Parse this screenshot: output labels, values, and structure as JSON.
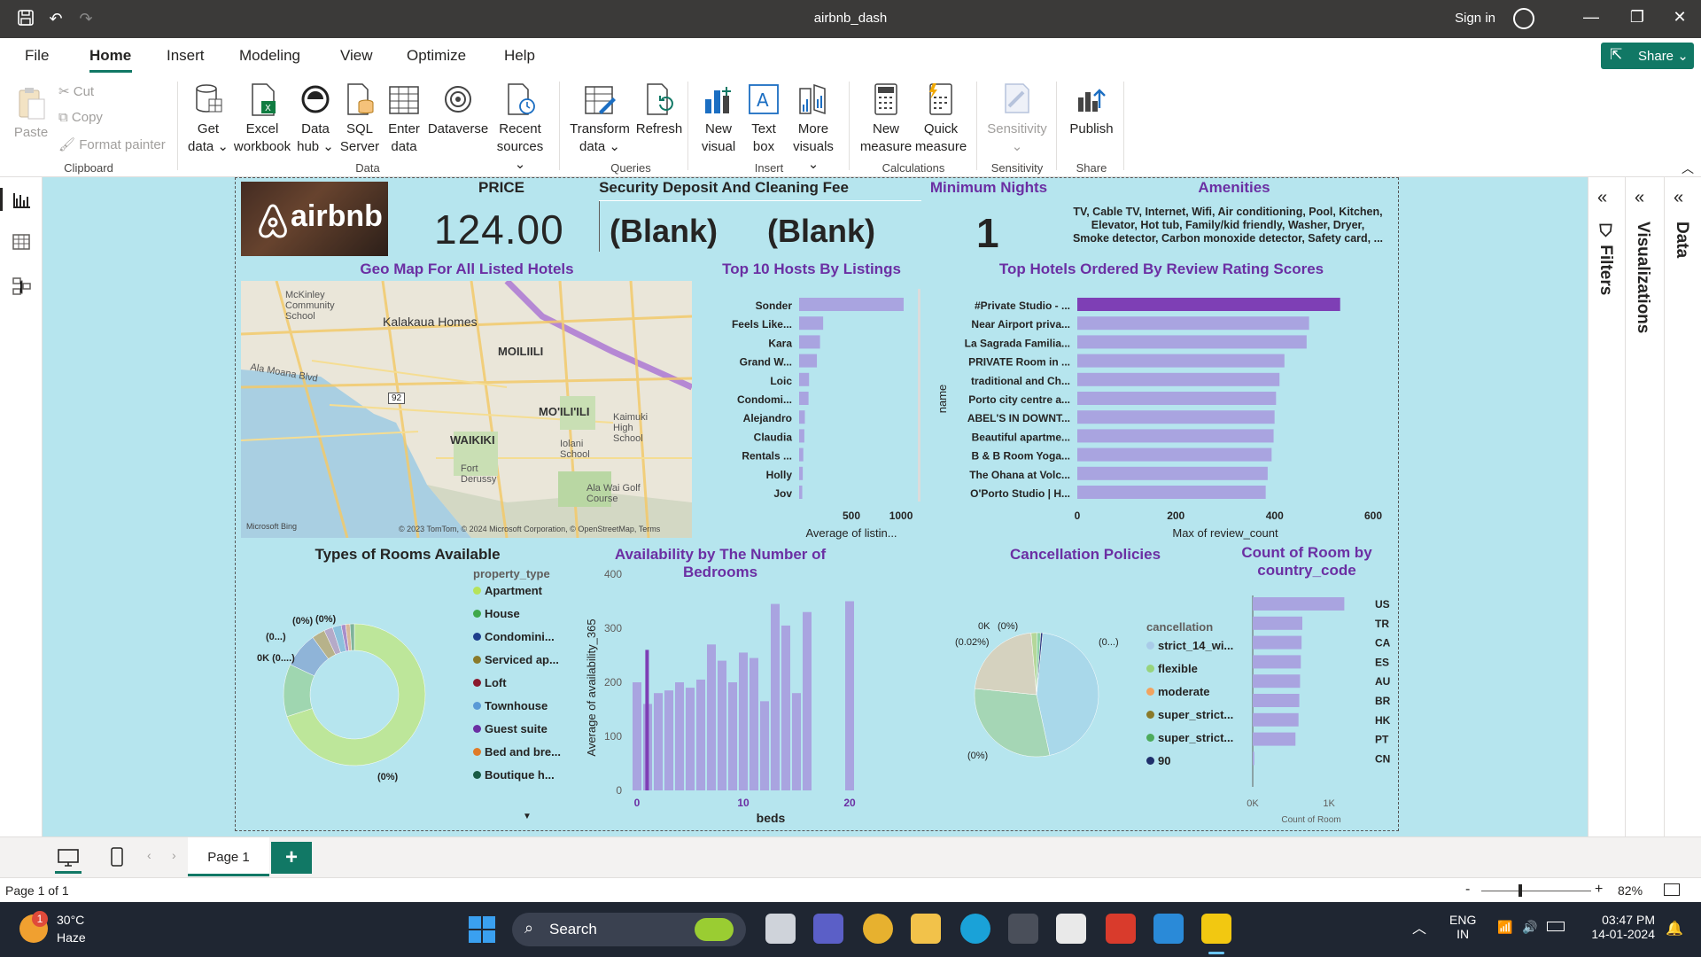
{
  "window": {
    "title": "airbnb_dash",
    "sign_in": "Sign in"
  },
  "menu": {
    "items": [
      "File",
      "Home",
      "Insert",
      "Modeling",
      "View",
      "Optimize",
      "Help"
    ],
    "active": "Home",
    "share": "Share"
  },
  "ribbon": {
    "clipboard": {
      "paste": "Paste",
      "cut": "Cut",
      "copy": "Copy",
      "format_painter": "Format painter",
      "label": "Clipboard"
    },
    "data": {
      "get_data": "Get data",
      "excel": "Excel workbook",
      "data_hub": "Data hub",
      "sql": "SQL Server",
      "enter": "Enter data",
      "dataverse": "Dataverse",
      "recent": "Recent sources",
      "label": "Data"
    },
    "queries": {
      "transform": "Transform data",
      "refresh": "Refresh",
      "label": "Queries"
    },
    "insert": {
      "new_visual": "New visual",
      "text_box": "Text box",
      "more": "More visuals",
      "label": "Insert"
    },
    "calc": {
      "new_measure": "New measure",
      "quick": "Quick measure",
      "label": "Calculations"
    },
    "sensitivity": {
      "btn": "Sensitivity",
      "label": "Sensitivity"
    },
    "share": {
      "publish": "Publish",
      "label": "Share"
    }
  },
  "report": {
    "logo_text": "airbnb",
    "price": {
      "title": "PRICE",
      "value": "124.00"
    },
    "deposit": {
      "title": "Security Deposit And Cleaning Fee",
      "v1": "(Blank)",
      "v2": "(Blank)"
    },
    "min_nights": {
      "title": "Minimum Nights",
      "value": "1"
    },
    "amenities": {
      "title": "Amenities",
      "line1": "TV, Cable TV, Internet, Wifi, Air conditioning, Pool, Kitchen,",
      "line2": "Elevator, Hot tub, Family/kid friendly, Washer, Dryer,",
      "line3": "Smoke detector, Carbon monoxide detector, Safety card, ..."
    },
    "map": {
      "title": "Geo Map For All Listed Hotels",
      "bing": "Microsoft Bing",
      "copyright": "© 2023 TomTom, © 2024 Microsoft Corporation, © OpenStreetMap, Terms",
      "places": [
        "McKinley Community School",
        "Kalakaua Homes",
        "MOILIILI",
        "MO'ILI'ILI",
        "Ala Moana Blvd",
        "WAIKIKI",
        "Fort Derussy",
        "Iolani School",
        "Ala Wai Golf Course",
        "Kaimuki High School",
        "92"
      ]
    },
    "donut": {
      "title": "Types of Rooms Available",
      "legend_title": "property_type",
      "labels": [
        "(0%)",
        "(0...)",
        "0K (0....)",
        "(0%)"
      ],
      "bottom_label": "(0%)"
    },
    "pie": {
      "title": "Cancellation Policies",
      "legend_title": "cancellation",
      "labels": [
        "0K",
        "(0%)",
        "(0.02%)",
        "(0...)",
        "(0%)"
      ]
    },
    "country": {
      "title_line1": "Count of Room by",
      "title_line2": "country_code",
      "xlabel": "Count of Room"
    }
  },
  "chart_data": [
    {
      "type": "bar",
      "orientation": "horizontal",
      "title": "Top 10 Hosts By Listings",
      "categories": [
        "Sonder",
        "Feels Like...",
        "Kara",
        "Grand W...",
        "Loic",
        "Condomi...",
        "Alejandro",
        "Claudia",
        "Rentals ...",
        "Holly",
        "Jov"
      ],
      "values": [
        1000,
        230,
        200,
        170,
        95,
        90,
        55,
        50,
        40,
        35,
        30
      ],
      "xlabel": "Average of listin...",
      "xticks": [
        "500",
        "1000"
      ],
      "xlim": [
        0,
        1000
      ],
      "color": "#a9a4e0"
    },
    {
      "type": "bar",
      "orientation": "horizontal",
      "title": "Top Hotels Ordered By Review Rating Scores",
      "categories": [
        "#Private Studio - ...",
        "Near Airport priva...",
        "La Sagrada Familia...",
        "PRIVATE Room in ...",
        "traditional and Ch...",
        "Porto city centre a...",
        "ABEL'S IN DOWNT...",
        "Beautiful apartme...",
        "B & B Room Yoga...",
        "The Ohana at Volc...",
        "O'Porto Studio | H..."
      ],
      "values": [
        533,
        470,
        465,
        420,
        410,
        403,
        400,
        398,
        394,
        386,
        382
      ],
      "xlabel": "Max of review_count",
      "ylabel": "name",
      "xticks": [
        "0",
        "200",
        "400",
        "600"
      ],
      "xlim": [
        0,
        600
      ],
      "color": "#a9a4e0",
      "highlight_color": "#7e3fb5"
    },
    {
      "type": "bar",
      "title": "Availability by The Number of Bedrooms",
      "x": [
        0,
        1,
        1.2,
        2,
        3,
        4,
        5,
        6,
        7,
        8,
        9,
        10,
        11,
        12,
        13,
        14,
        15,
        16,
        20
      ],
      "values": [
        200,
        160,
        260,
        180,
        185,
        200,
        190,
        205,
        270,
        240,
        200,
        255,
        245,
        165,
        345,
        305,
        180,
        330,
        350
      ],
      "xlabel": "beds",
      "ylabel": "Average of availability_365",
      "yticks": [
        "0",
        "100",
        "200",
        "300",
        "400"
      ],
      "xticks": [
        "0",
        "10",
        "20"
      ],
      "ylim": [
        0,
        400
      ],
      "color": "#a9a4e0",
      "highlight_color": "#7e3fb5"
    },
    {
      "type": "pie",
      "subtype": "donut",
      "title": "Types of Rooms Available",
      "categories": [
        "Apartment",
        "House",
        "Condomini...",
        "Serviced ap...",
        "Loft",
        "Townhouse",
        "Guest suite",
        "Bed and bre...",
        "Boutique h..."
      ],
      "values": [
        70,
        12,
        8,
        3,
        2,
        2,
        1,
        1,
        1
      ],
      "colors": [
        "#bde69a",
        "#9fd6b0",
        "#8fb4d8",
        "#b7b28a",
        "#b5aac8",
        "#8cc1dc",
        "#a98ec9",
        "#d8b99b",
        "#7fb39a"
      ],
      "legend_colors": [
        "#b6e35a",
        "#3fa84a",
        "#1f3f8c",
        "#8a7a2a",
        "#8b1a2e",
        "#5a9ad6",
        "#6b2fa3",
        "#e07b28",
        "#185b45"
      ]
    },
    {
      "type": "pie",
      "title": "Cancellation Policies",
      "categories": [
        "strict_14_wi...",
        "flexible",
        "moderate",
        "super_strict...",
        "super_strict...",
        "90"
      ],
      "values": [
        45,
        30,
        22,
        1.5,
        1,
        0.5
      ],
      "colors": [
        "#a9d8ea",
        "#a5d6b5",
        "#d5d2bf",
        "#b5d79a",
        "#8fd3a6",
        "#2b3a80"
      ],
      "legend_colors": [
        "#a9cbe8",
        "#97d47c",
        "#f2a35f",
        "#8a7a2a",
        "#4cab5b",
        "#1f2f6b"
      ]
    },
    {
      "type": "bar",
      "orientation": "horizontal",
      "title": "Count of Room by country_code",
      "categories": [
        "US",
        "TR",
        "CA",
        "ES",
        "AU",
        "BR",
        "HK",
        "PT",
        "CN"
      ],
      "values": [
        1200,
        650,
        640,
        630,
        620,
        610,
        600,
        560,
        20
      ],
      "xlabel": "Count of Room",
      "xticks": [
        "0K",
        "1K"
      ],
      "xlim": [
        0,
        1300
      ],
      "color": "#a9a4e0"
    }
  ],
  "pages": {
    "tab": "Page 1",
    "status": "Page 1 of 1",
    "zoom": "82%"
  },
  "panes": {
    "filters": "Filters",
    "visualizations": "Visualizations",
    "data": "Data"
  },
  "taskbar": {
    "weather_temp": "30°C",
    "weather_desc": "Haze",
    "search": "Search",
    "lang1": "ENG",
    "lang2": "IN",
    "time": "03:47 PM",
    "date": "14-01-2024",
    "badge": "1"
  }
}
